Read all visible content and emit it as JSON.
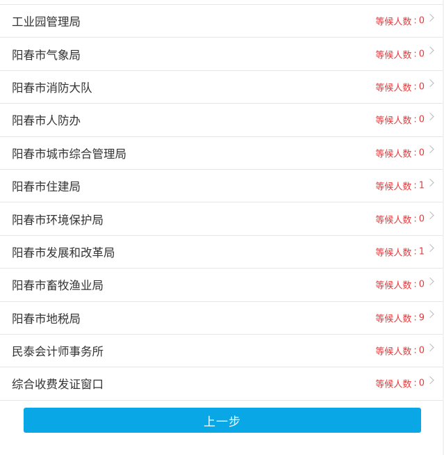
{
  "wait": {
    "label": "等候人数",
    "colon": ":"
  },
  "offices": [
    {
      "name": "工业园管理局",
      "count": "0"
    },
    {
      "name": "阳春市气象局",
      "count": "0"
    },
    {
      "name": "阳春市消防大队",
      "count": "0"
    },
    {
      "name": "阳春市人防办",
      "count": "0"
    },
    {
      "name": "阳春市城市综合管理局",
      "count": "0"
    },
    {
      "name": "阳春市住建局",
      "count": "1"
    },
    {
      "name": "阳春市环境保护局",
      "count": "0"
    },
    {
      "name": "阳春市发展和改革局",
      "count": "1"
    },
    {
      "name": "阳春市畜牧渔业局",
      "count": "0"
    },
    {
      "name": "阳春市地税局",
      "count": "9"
    },
    {
      "name": "民泰会计师事务所",
      "count": "0"
    },
    {
      "name": "综合收费发证窗口",
      "count": "0"
    }
  ],
  "footer": {
    "prev_label": "上一步"
  },
  "colors": {
    "accent_button": "#0aa7e6",
    "count_text": "#e4393c"
  },
  "icons": {
    "row_arrow": "chevron-right-icon"
  }
}
